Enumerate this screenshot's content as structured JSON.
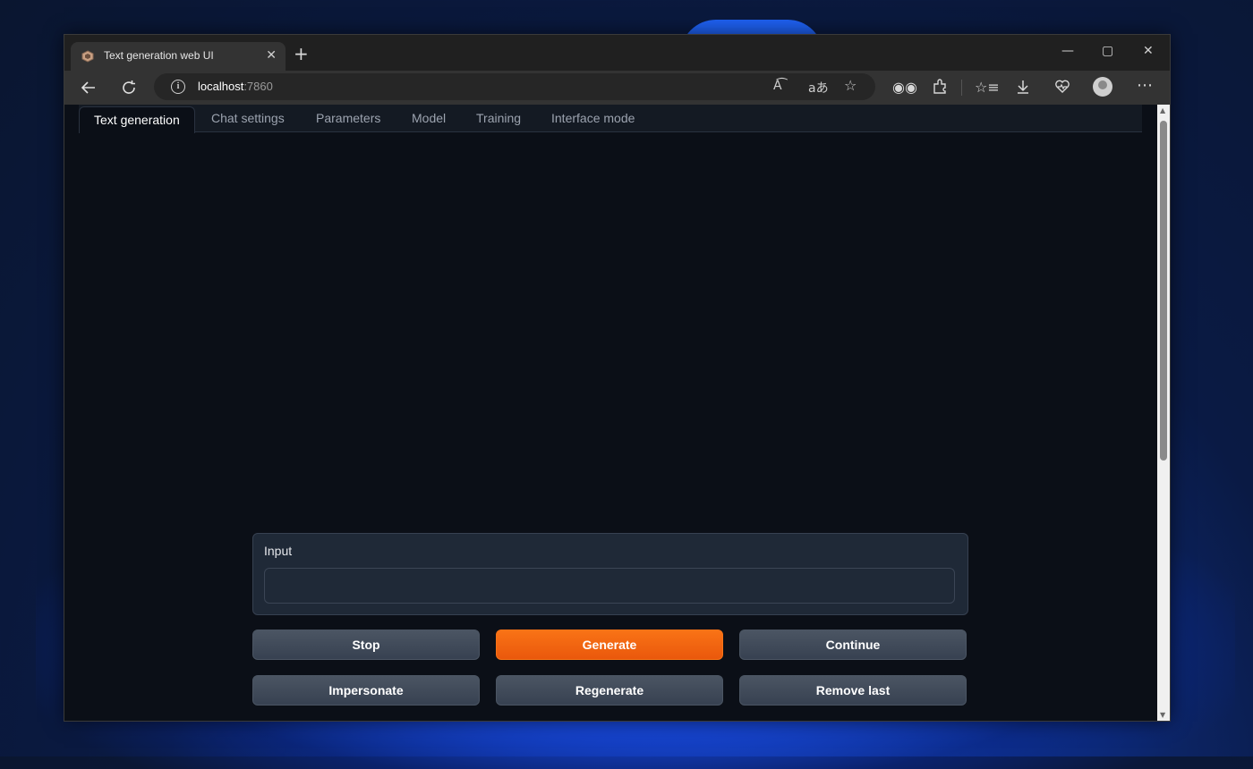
{
  "browser": {
    "tab_title": "Text generation web UI",
    "tab_close_glyph": "✕",
    "new_tab_glyph": "+",
    "window_controls": {
      "minimize": "—",
      "maximize": "▢",
      "close": "✕"
    },
    "url_host": "localhost",
    "url_port": ":7860",
    "icons": [
      "back-icon",
      "refresh-icon",
      "info-icon",
      "read-aloud-icon",
      "translate-icon",
      "favorite-icon",
      "extension-icon-1",
      "extensions-icon",
      "favorites-icon",
      "downloads-icon",
      "health-icon",
      "profile-icon",
      "more-icon"
    ]
  },
  "app": {
    "tabs": [
      {
        "label": "Text generation",
        "active": true
      },
      {
        "label": "Chat settings",
        "active": false
      },
      {
        "label": "Parameters",
        "active": false
      },
      {
        "label": "Model",
        "active": false
      },
      {
        "label": "Training",
        "active": false
      },
      {
        "label": "Interface mode",
        "active": false
      }
    ],
    "input": {
      "label": "Input",
      "value": "",
      "placeholder": ""
    },
    "buttons": {
      "stop": "Stop",
      "generate": "Generate",
      "continue": "Continue",
      "impersonate": "Impersonate",
      "regenerate": "Regenerate",
      "remove_last": "Remove last"
    }
  },
  "colors": {
    "accent": "#f97316",
    "background": "#0b0f17",
    "panel": "#1f2937"
  }
}
